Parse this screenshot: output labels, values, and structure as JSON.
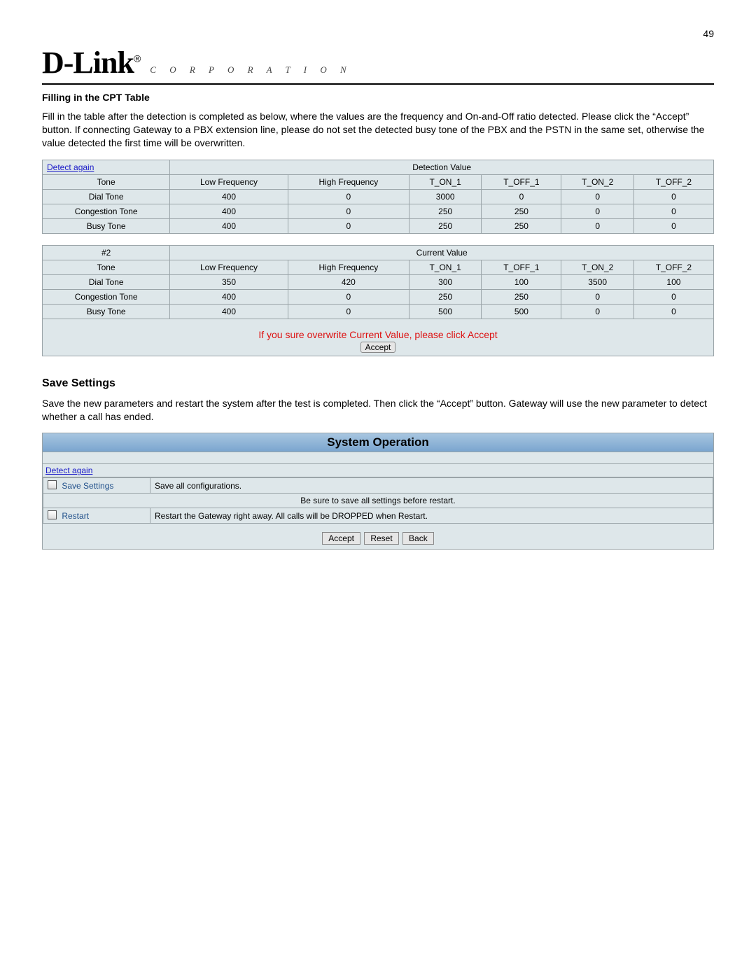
{
  "page_number": "49",
  "brand": {
    "name": "D-Link",
    "reg": "®",
    "tagline": "C O R P O R A T I O N"
  },
  "cpt": {
    "heading": "Filling in the CPT Table",
    "paragraph": "Fill in the table after the detection is completed as below, where the values are the frequency and On-and-Off ratio detected. Please click the “Accept” button. If connecting Gateway to a PBX extension line, please do not set the detected busy tone of the PBX and the PSTN in the same set, otherwise the value detected the first time will be overwritten."
  },
  "detection": {
    "detect_link": "Detect again",
    "title": "Detection Value",
    "cols": [
      "Tone",
      "Low Frequency",
      "High Frequency",
      "T_ON_1",
      "T_OFF_1",
      "T_ON_2",
      "T_OFF_2"
    ],
    "rows": [
      {
        "name": "Dial Tone",
        "lf": "400",
        "hf": "0",
        "on1": "3000",
        "off1": "0",
        "on2": "0",
        "off2": "0"
      },
      {
        "name": "Congestion Tone",
        "lf": "400",
        "hf": "0",
        "on1": "250",
        "off1": "250",
        "on2": "0",
        "off2": "0"
      },
      {
        "name": "Busy Tone",
        "lf": "400",
        "hf": "0",
        "on1": "250",
        "off1": "250",
        "on2": "0",
        "off2": "0"
      }
    ]
  },
  "current": {
    "set_label": "#2",
    "title": "Current Value",
    "cols": [
      "Tone",
      "Low Frequency",
      "High Frequency",
      "T_ON_1",
      "T_OFF_1",
      "T_ON_2",
      "T_OFF_2"
    ],
    "rows": [
      {
        "name": "Dial Tone",
        "lf": "350",
        "hf": "420",
        "on1": "300",
        "off1": "100",
        "on2": "3500",
        "off2": "100"
      },
      {
        "name": "Congestion Tone",
        "lf": "400",
        "hf": "0",
        "on1": "250",
        "off1": "250",
        "on2": "0",
        "off2": "0"
      },
      {
        "name": "Busy Tone",
        "lf": "400",
        "hf": "0",
        "on1": "500",
        "off1": "500",
        "on2": "0",
        "off2": "0"
      }
    ]
  },
  "overwrite_warning": "If you sure overwrite Current Value, please click Accept",
  "accept_label": "Accept",
  "save_section": {
    "heading": "Save Settings",
    "paragraph": "Save the new parameters and restart the system after the test is completed. Then click the “Accept” button. Gateway will use the new parameter to detect whether a call has ended."
  },
  "sysop": {
    "title": "System Operation",
    "detect_link": "Detect again",
    "save_label": "Save Settings",
    "save_desc": "Save all configurations.",
    "warn_row": "Be sure to save all settings before restart.",
    "restart_label": "Restart",
    "restart_desc": "Restart the Gateway right away. All calls will be DROPPED when Restart.",
    "buttons": {
      "accept": "Accept",
      "reset": "Reset",
      "back": "Back"
    }
  }
}
